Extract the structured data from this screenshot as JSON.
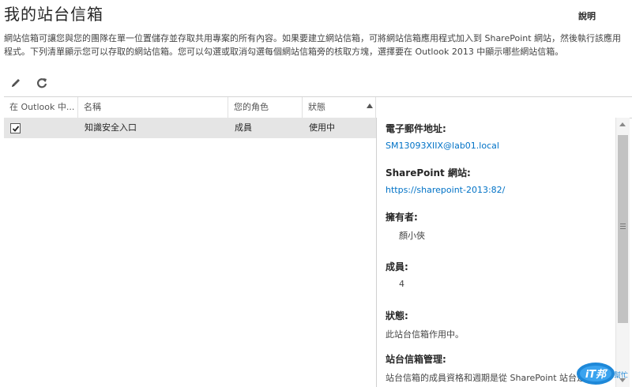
{
  "page": {
    "title": "我的站台信箱",
    "help_label": "說明",
    "description_line1": "網站信箱可讓您與您的團隊在單一位置儲存並存取共用專案的所有內容。如果要建立網站信箱，可將網站信箱應用程式加入到 SharePoint 網站，然後執行該應用程式。下列清單顯示您可以存取的網站信箱。您可以勾選或取消勾選每個網站信箱旁的核取方塊，選擇要在 Outlook 2013 中顯示哪些網站信箱。"
  },
  "toolbar": {
    "edit_icon": "pencil-icon",
    "refresh_icon": "refresh-icon"
  },
  "grid": {
    "columns": [
      "在 Outlook 中...",
      "名稱",
      "您的角色",
      "狀態"
    ],
    "sort_column": "狀態",
    "rows": [
      {
        "show_in_outlook": true,
        "name": "知識安全入口",
        "role": "成員",
        "status": "使用中"
      }
    ]
  },
  "details": {
    "email_label": "電子郵件地址:",
    "email_value": "SM13093XIIX@lab01.local",
    "site_label": "SharePoint 網站:",
    "site_value": "https://sharepoint-2013:82/",
    "owner_label": "擁有者:",
    "owner_value": "顏小俠",
    "members_label": "成員:",
    "members_value": "4",
    "status_label": "狀態:",
    "status_value": "此站台信箱作用中。",
    "management_label": "站台信箱管理:",
    "management_value": "站台信箱的成員資格和週期是從 SharePoint 站台進"
  },
  "watermark": {
    "text_main": "iT邦",
    "text_sub": "幫忙"
  },
  "colors": {
    "link": "#0072c6",
    "selected_row": "#e5e5e5",
    "watermark_blue": "#1e88d8"
  }
}
